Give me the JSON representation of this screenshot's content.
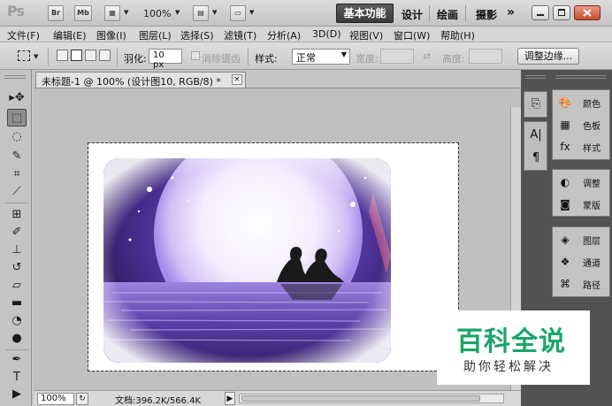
{
  "appbar": {
    "logo": "Ps",
    "bridge_label": "Br",
    "minibridge_label": "Mb",
    "zoom": "100%",
    "workspaces": {
      "active": "基本功能",
      "design": "设计",
      "painting": "绘画",
      "photography": "摄影"
    },
    "more": "»"
  },
  "menu": [
    "文件(F)",
    "编辑(E)",
    "图像(I)",
    "图层(L)",
    "选择(S)",
    "滤镜(T)",
    "分析(A)",
    "3D(D)",
    "视图(V)",
    "窗口(W)",
    "帮助(H)"
  ],
  "options": {
    "feather_label": "羽化:",
    "feather_value": "10 px",
    "antialias_label": "消除锯齿",
    "style_label": "样式:",
    "style_value": "正常",
    "width_label": "宽度:",
    "height_label": "高度:",
    "refine_edge": "调整边缘..."
  },
  "document": {
    "tab_title": "未标题-1 @ 100% (设计图10, RGB/8) *",
    "tab_close": "×",
    "zoom": "100%",
    "info": "文档:396.2K/566.4K"
  },
  "panels": {
    "group1": [
      "颜色",
      "色板",
      "样式"
    ],
    "group2": [
      "调整",
      "蒙版"
    ],
    "group3": [
      "图层",
      "通道",
      "路径"
    ]
  },
  "watermark": {
    "title": "百科全说",
    "subtitle": "助你轻松解决"
  },
  "colors": {
    "watermark_green": "#1aa56a",
    "workspace_active_bg": "#4a4a4a"
  }
}
